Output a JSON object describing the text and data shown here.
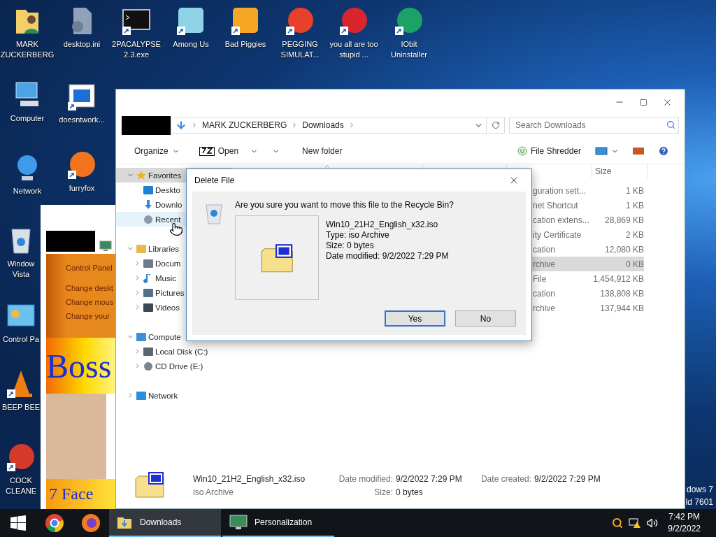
{
  "desktop": {
    "icons": [
      {
        "label": "MARK ZUCKERBERG",
        "kind": "user-folder",
        "shortcut": false
      },
      {
        "label": "desktop.ini",
        "kind": "settings-file",
        "shortcut": false
      },
      {
        "label": "2PACALYPSE 2.3.exe",
        "kind": "console",
        "shortcut": true
      },
      {
        "label": "Among Us",
        "kind": "app",
        "color": "#8fd3e8",
        "shortcut": true
      },
      {
        "label": "Bad Piggies",
        "kind": "app",
        "color": "#f5a623",
        "shortcut": true
      },
      {
        "label": "PEGGING SIMULAT...",
        "kind": "round-app",
        "color": "#e8402a",
        "shortcut": true
      },
      {
        "label": "you all are too stupid ...",
        "kind": "round-app",
        "color": "#d9262e",
        "shortcut": true
      },
      {
        "label": "IObit Uninstaller",
        "kind": "round-app",
        "color": "#1aa364",
        "shortcut": true
      },
      {
        "label": "Computer",
        "kind": "computer",
        "shortcut": false
      },
      {
        "label": "doesntwork...",
        "kind": "window",
        "shortcut": true
      },
      {
        "label": "Network",
        "kind": "globe",
        "shortcut": false
      },
      {
        "label": "furryfox",
        "kind": "round-app",
        "color": "#f4731f",
        "shortcut": true
      },
      {
        "label": "Window Vista",
        "kind": "recycle-bin",
        "shortcut": false
      },
      {
        "label": "Control Pa",
        "kind": "control-panel",
        "shortcut": false
      },
      {
        "label": "BEEP BEE",
        "kind": "cone",
        "shortcut": true
      },
      {
        "label": "COCK CLEANE",
        "kind": "round-app",
        "color": "#d43a2a",
        "shortcut": true
      }
    ],
    "notice": [
      "dows 7",
      "ld 7601"
    ]
  },
  "background_window": {
    "links": [
      "Control Panel",
      "Change deskt",
      "Change mous",
      "Change your"
    ],
    "banner": "Boss",
    "caption": "7 Face"
  },
  "explorer": {
    "breadcrumb": [
      "MARK ZUCKERBERG",
      "Downloads"
    ],
    "search": {
      "placeholder": "Search Downloads"
    },
    "toolbar": [
      "Organize",
      "Open",
      "New folder"
    ],
    "file_shredder": "File Shredder",
    "nav": [
      {
        "label": "Favorites",
        "kind": "star",
        "expanded": true,
        "selected": true,
        "hovered": false,
        "children": [
          {
            "label": "Deskto",
            "kind": "desktop",
            "selected": false,
            "hovered": false
          },
          {
            "label": "Downlo",
            "kind": "download",
            "selected": false,
            "hovered": false
          },
          {
            "label": "Recent",
            "kind": "recent",
            "selected": false,
            "hovered": true
          }
        ]
      },
      {
        "label": "Libraries",
        "kind": "library",
        "expanded": true,
        "selected": false,
        "hovered": false,
        "children": [
          {
            "label": "Docum",
            "kind": "document",
            "expanded": false,
            "selected": false,
            "hovered": false
          },
          {
            "label": "Music",
            "kind": "music",
            "expanded": false,
            "selected": false,
            "hovered": false
          },
          {
            "label": "Pictures",
            "kind": "picture",
            "expanded": false,
            "selected": false,
            "hovered": false
          },
          {
            "label": "Videos",
            "kind": "video",
            "expanded": false,
            "selected": false,
            "hovered": false
          }
        ]
      },
      {
        "label": "Compute",
        "kind": "computer",
        "expanded": true,
        "selected": false,
        "hovered": false,
        "children": [
          {
            "label": "Local Disk (C:)",
            "kind": "disk",
            "expanded": false,
            "selected": false,
            "hovered": false
          },
          {
            "label": "CD Drive (E:)",
            "kind": "cd",
            "expanded": false,
            "selected": false,
            "hovered": false
          }
        ]
      },
      {
        "label": "Network",
        "kind": "network",
        "expanded": false,
        "selected": false,
        "hovered": false
      }
    ],
    "columns": [
      "Size"
    ],
    "rows": [
      {
        "type": "guration sett...",
        "size": "1 KB",
        "selected": false
      },
      {
        "type": "net Shortcut",
        "size": "1 KB",
        "selected": false
      },
      {
        "type": "cation extens...",
        "size": "28,869 KB",
        "selected": false
      },
      {
        "type": "ity Certificate",
        "size": "2 KB",
        "selected": false
      },
      {
        "type": "cation",
        "size": "12,080 KB",
        "selected": false
      },
      {
        "type": "rchive",
        "size": "0 KB",
        "selected": true
      },
      {
        "type": "File",
        "size": "1,454,912 KB",
        "selected": false
      },
      {
        "type": "cation",
        "size": "138,808 KB",
        "selected": false
      },
      {
        "type": "rchive",
        "size": "137,944 KB",
        "selected": false
      }
    ],
    "details": {
      "name": "Win10_21H2_English_x32.iso",
      "type": "iso Archive",
      "modified_label": "Date modified:",
      "modified": "9/2/2022 7:29 PM",
      "size_label": "Size:",
      "size": "0 bytes",
      "created_label": "Date created:",
      "created": "9/2/2022 7:29 PM"
    }
  },
  "dialog": {
    "title": "Delete File",
    "question": "Are you sure you want to move this file to the Recycle Bin?",
    "file_info": [
      "Win10_21H2_English_x32.iso",
      "Type: iso Archive",
      "Size: 0 bytes",
      "Date modified: 9/2/2022 7:29 PM"
    ],
    "buttons": [
      {
        "label": "Yes",
        "selected": true
      },
      {
        "label": "No",
        "selected": false
      }
    ]
  },
  "taskbar": {
    "windows": [
      {
        "label": "Downloads",
        "kind": "folder",
        "selected": true
      },
      {
        "label": "Personalization",
        "kind": "monitor",
        "selected": false
      }
    ],
    "time": "7:42 PM",
    "date": "9/2/2022"
  }
}
